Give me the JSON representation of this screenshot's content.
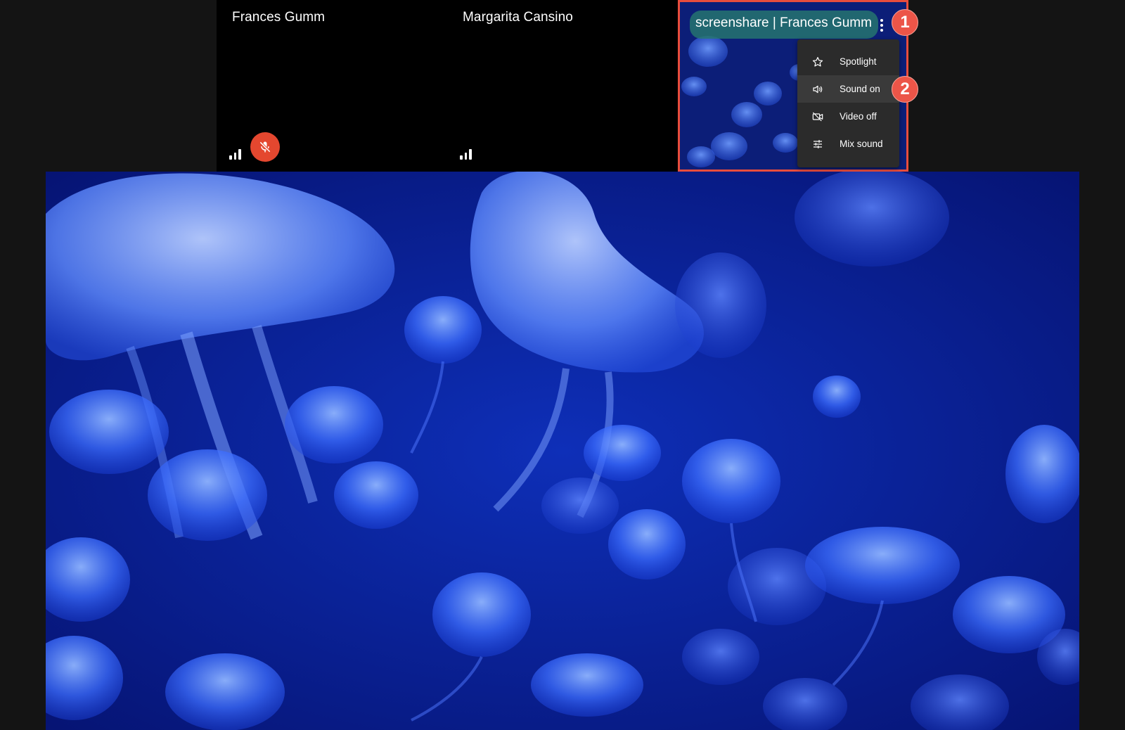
{
  "participants": [
    {
      "name": "Frances Gumm",
      "muted": true
    },
    {
      "name": "Margarita Cansino",
      "muted": false
    }
  ],
  "screenshare": {
    "title": "screenshare | Frances Gumm"
  },
  "menu": {
    "items": [
      {
        "label": "Spotlight",
        "icon": "star-icon"
      },
      {
        "label": "Sound on",
        "icon": "speaker-icon"
      },
      {
        "label": "Video off",
        "icon": "video-off-icon"
      },
      {
        "label": "Mix sound",
        "icon": "sliders-icon"
      }
    ]
  },
  "annotations": {
    "badge1": "1",
    "badge2": "2"
  },
  "colors": {
    "accent_red": "#e84d3d",
    "mute_red": "#e4472f",
    "menu_bg": "#2b2b2b",
    "jelly_blue": "#1f55f5"
  }
}
